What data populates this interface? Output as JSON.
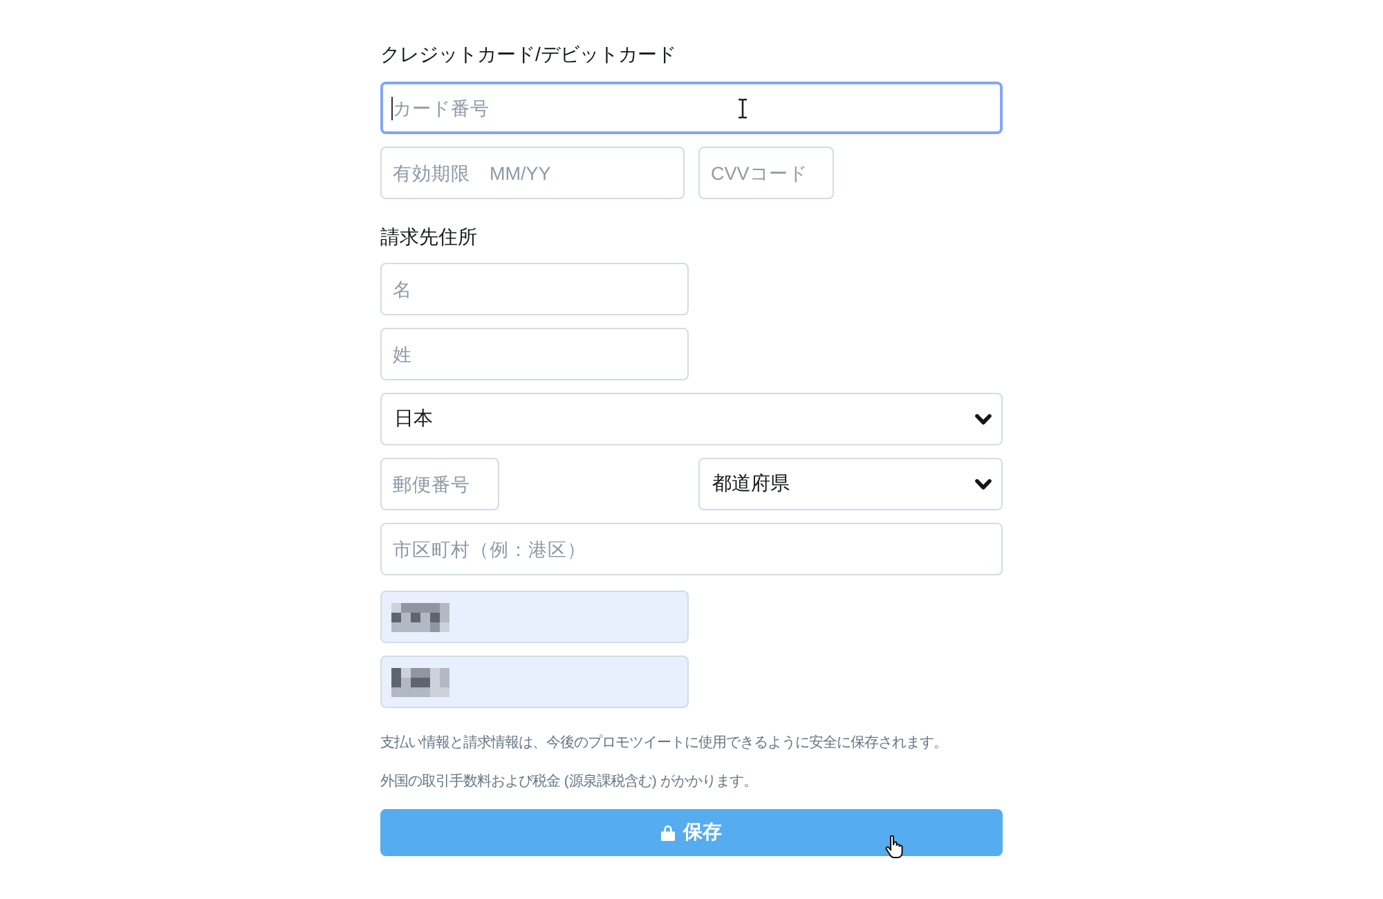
{
  "card_section": {
    "heading": "クレジットカード/デビットカード",
    "card_number": {
      "placeholder": "カード番号",
      "focused": true
    },
    "expiry": {
      "placeholder": "有効期限　MM/YY",
      "focused": false
    },
    "cvv": {
      "placeholder": "CVVコード",
      "focused": false
    }
  },
  "billing_section": {
    "heading": "請求先住所",
    "first_name": {
      "placeholder": "名"
    },
    "last_name": {
      "placeholder": "姓"
    },
    "country": {
      "value": "日本"
    },
    "postal_code": {
      "placeholder": "郵便番号"
    },
    "prefecture": {
      "value": "都道府県"
    },
    "city": {
      "placeholder": "市区町村（例：港区）"
    },
    "address_lines": [
      {
        "autofilled": true,
        "redacted": true
      },
      {
        "autofilled": true,
        "redacted": true
      }
    ]
  },
  "notes": [
    "支払い情報と請求情報は、今後のプロモツイートに使用できるように安全に保存されます。",
    "外国の取引手数料および税金 (源泉課税含む) がかかります。"
  ],
  "save_button": {
    "label": "保存"
  }
}
